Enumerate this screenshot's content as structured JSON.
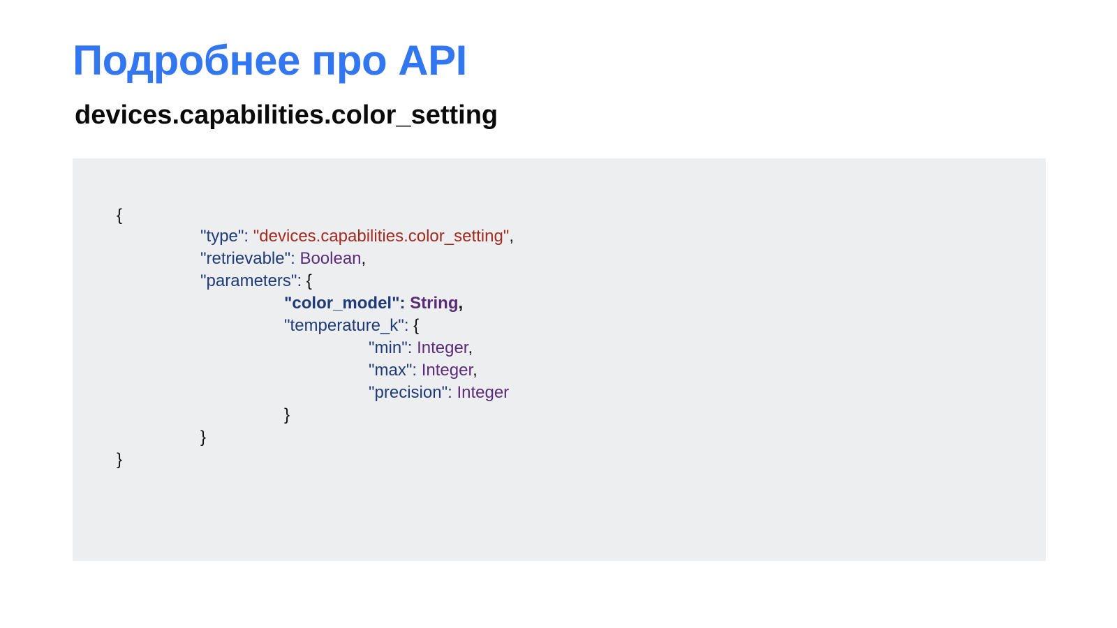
{
  "slide": {
    "title": "Подробнее про API",
    "subtitle": "devices.capabilities.color_setting"
  },
  "code": {
    "open_brace": "{",
    "type_key": "\"type\"",
    "type_value": "\"devices.capabilities.color_setting\"",
    "retrievable_key": "\"retrievable\"",
    "retrievable_value": "Boolean",
    "parameters_key": "\"parameters\"",
    "color_model_key": "\"color_model\"",
    "color_model_value": "String",
    "temperature_key": "\"temperature_k\"",
    "min_key": "\"min\"",
    "min_value": "Integer",
    "max_key": "\"max\"",
    "max_value": "Integer",
    "precision_key": "\"precision\"",
    "precision_value": "Integer",
    "close_temperature": "}",
    "close_parameters": "}",
    "close_root": "}"
  },
  "colors": {
    "title": "#3377f0",
    "code_background": "#edeef0",
    "key": "#1f3a78",
    "string_value": "#a32a1f",
    "type_value": "#5a2b78"
  }
}
